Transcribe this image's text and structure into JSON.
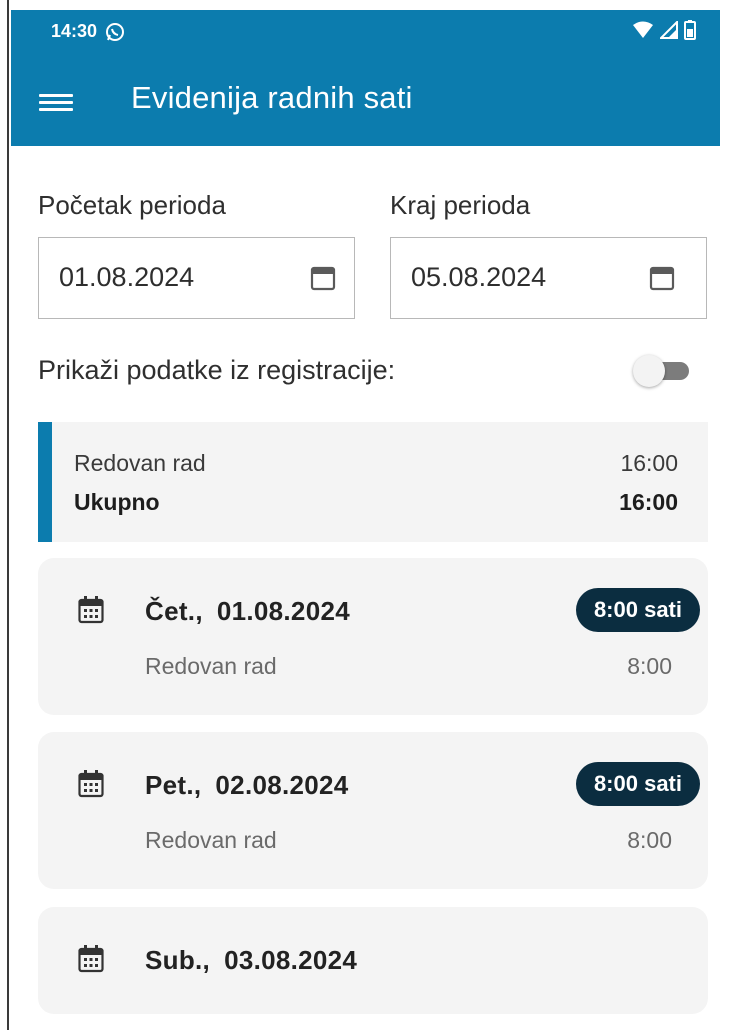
{
  "status": {
    "time": "14:30",
    "icons": [
      "whatsapp-icon",
      "wifi-icon",
      "signal-icon",
      "battery-icon"
    ]
  },
  "header": {
    "title": "Evidenija radnih sati"
  },
  "period": {
    "start_label": "Početak perioda",
    "start_value": "01.08.2024",
    "end_label": "Kraj perioda",
    "end_value": "05.08.2024"
  },
  "toggle": {
    "label": "Prikaži podatke iz registracije:",
    "on": false
  },
  "summary": {
    "rows": [
      {
        "label": "Redovan rad",
        "value": "16:00"
      },
      {
        "label": "Ukupno",
        "value": "16:00"
      }
    ]
  },
  "days": [
    {
      "weekday": "Čet.,",
      "date": "01.08.2024",
      "badge": "8:00 sati",
      "entry_label": "Redovan rad",
      "entry_value": "8:00"
    },
    {
      "weekday": "Pet.,",
      "date": "02.08.2024",
      "badge": "8:00 sati",
      "entry_label": "Redovan rad",
      "entry_value": "8:00"
    },
    {
      "weekday": "Sub.,",
      "date": "03.08.2024"
    }
  ],
  "colors": {
    "primary": "#0c7cae",
    "badge": "#0b2d40",
    "card": "#f4f4f4"
  }
}
